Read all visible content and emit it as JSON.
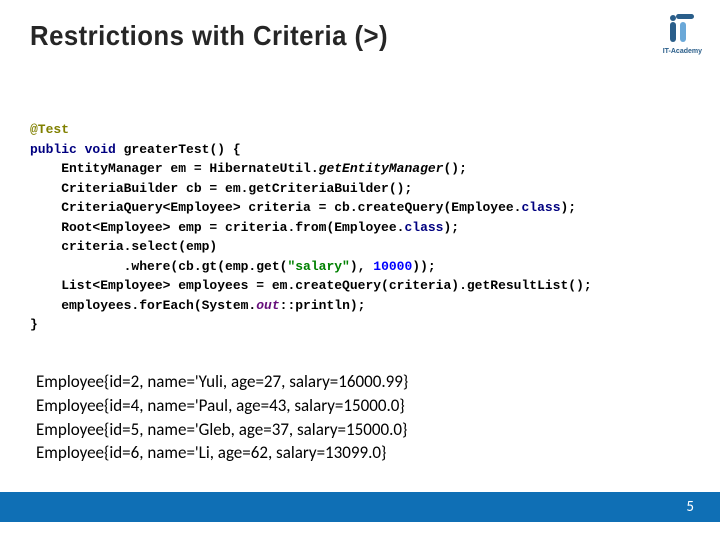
{
  "title": "Restrictions with Criteria (>)",
  "logo_label": "IT-Academy",
  "code": {
    "l1_ann": "@Test",
    "l2_a": "public void ",
    "l2_b": "greaterTest() {",
    "l3_a": "    EntityManager em = HibernateUtil.",
    "l3_b": "getEntityManager",
    "l3_c": "();",
    "l4": "    CriteriaBuilder cb = em.getCriteriaBuilder();",
    "l5_a": "    CriteriaQuery<Employee> criteria = cb.createQuery(Employee.",
    "l5_b": "class",
    "l5_c": ");",
    "l6_a": "    Root<Employee> emp = criteria.from(Employee.",
    "l6_b": "class",
    "l6_c": ");",
    "l7": "    criteria.select(emp)",
    "l8_a": "            .where(cb.gt(emp.get(",
    "l8_b": "\"salary\"",
    "l8_c": "), ",
    "l8_d": "10000",
    "l8_e": "));",
    "l9": "    List<Employee> employees = em.createQuery(criteria).getResultList();",
    "l10_a": "    employees.forEach(System.",
    "l10_b": "out",
    "l10_c": "::println);",
    "l11": "}"
  },
  "output": [
    "Employee{id=2, name='Yuli, age=27, salary=16000.99}",
    "Employee{id=4, name='Paul, age=43, salary=15000.0}",
    "Employee{id=5, name='Gleb, age=37, salary=15000.0}",
    "Employee{id=6, name='Li, age=62, salary=13099.0}"
  ],
  "page_number": "5"
}
